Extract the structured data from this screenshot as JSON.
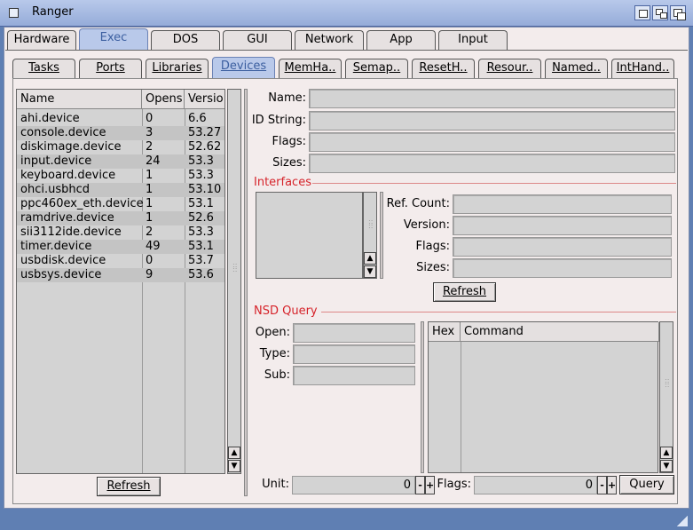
{
  "window": {
    "title": "Ranger"
  },
  "main_tabs": [
    "Hardware",
    "Exec",
    "DOS",
    "GUI",
    "Network",
    "App",
    "Input"
  ],
  "sub_tabs": [
    "Tasks",
    "Ports",
    "Libraries",
    "Devices",
    "MemHa..",
    "Semap..",
    "ResetH..",
    "Resour..",
    "Named..",
    "IntHand.."
  ],
  "device_list": {
    "columns": [
      "Name",
      "Opens",
      "Versio"
    ],
    "rows": [
      [
        "ahi.device",
        "0",
        "6.6"
      ],
      [
        "console.device",
        "3",
        "53.27"
      ],
      [
        "diskimage.device",
        "2",
        "52.62"
      ],
      [
        "input.device",
        "24",
        "53.3"
      ],
      [
        "keyboard.device",
        "1",
        "53.3"
      ],
      [
        "ohci.usbhcd",
        "1",
        "53.10"
      ],
      [
        "ppc460ex_eth.device",
        "1",
        "53.1"
      ],
      [
        "ramdrive.device",
        "1",
        "52.6"
      ],
      [
        "sii3112ide.device",
        "2",
        "53.3"
      ],
      [
        "timer.device",
        "49",
        "53.1"
      ],
      [
        "usbdisk.device",
        "0",
        "53.7"
      ],
      [
        "usbsys.device",
        "9",
        "53.6"
      ]
    ],
    "refresh_label": "Refresh"
  },
  "details": {
    "name_label": "Name:",
    "id_string_label": "ID String:",
    "flags_label": "Flags:",
    "sizes_label": "Sizes:"
  },
  "interfaces": {
    "title": "Interfaces",
    "ref_count_label": "Ref. Count:",
    "version_label": "Version:",
    "flags_label": "Flags:",
    "sizes_label": "Sizes:",
    "refresh_label": "Refresh"
  },
  "nsd_query": {
    "title": "NSD Query",
    "open_label": "Open:",
    "type_label": "Type:",
    "sub_label": "Sub:",
    "columns": [
      "Hex",
      "Command"
    ],
    "unit_label": "Unit:",
    "unit_value": "0",
    "flags_label": "Flags:",
    "flags_value": "0",
    "query_label": "Query",
    "minus": "-",
    "plus": "+"
  }
}
